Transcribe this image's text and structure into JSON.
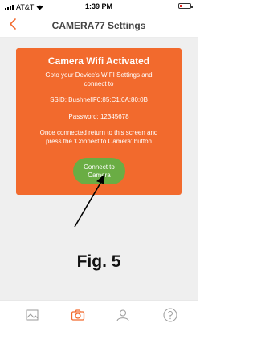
{
  "status_bar": {
    "carrier": "AT&T",
    "time": "1:39 PM"
  },
  "nav": {
    "title": "CAMERA77 Settings",
    "back_icon": "chevron-left-icon"
  },
  "card": {
    "title": "Camera Wifi Activated",
    "line1": "Goto your Device's WIFI Settings and",
    "line2": "connect to",
    "ssid": "SSID: BushnellF0:85:C1:0A:80:0B",
    "password": "Password: 12345678",
    "line3": "Once connected return to this screen and",
    "line4": "press the 'Connect to Camera' button",
    "button_line1": "Connect to",
    "button_line2": "Camera"
  },
  "annotation": {
    "figure_label": "Fig. 5"
  },
  "tabbar": {
    "items": [
      {
        "icon": "image-icon"
      },
      {
        "icon": "camera-icon"
      },
      {
        "icon": "user-icon"
      },
      {
        "icon": "help-icon"
      }
    ]
  },
  "colors": {
    "accent": "#f26a2d",
    "button": "#6aad44",
    "battery_low": "#e0271f"
  }
}
